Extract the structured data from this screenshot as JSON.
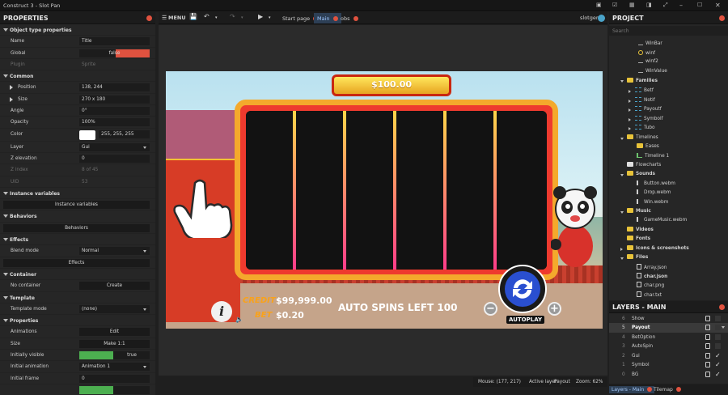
{
  "window": {
    "title": "Construct 3 - Slot Pan"
  },
  "properties": {
    "title": "PROPERTIES",
    "object_type_section": "Object type properties",
    "name_label": "Name",
    "name_value": "Title",
    "global_label": "Global",
    "global_value": "false",
    "plugin_label": "Plugin",
    "plugin_value": "Sprite",
    "common_section": "Common",
    "position_label": "Position",
    "position_value": "138, 244",
    "size_label": "Size",
    "size_value": "270 x 180",
    "angle_label": "Angle",
    "angle_value": "0°",
    "opacity_label": "Opacity",
    "opacity_value": "100%",
    "color_label": "Color",
    "color_value": "255, 255, 255",
    "layer_label": "Layer",
    "layer_value": "Gui",
    "zelev_label": "Z elevation",
    "zelev_value": "0",
    "zindex_label": "Z index",
    "zindex_value": "8 of 45",
    "uid_label": "UID",
    "uid_value": "53",
    "instvars_section": "Instance variables",
    "instvars_button": "Instance variables",
    "behaviors_section": "Behaviors",
    "behaviors_button": "Behaviors",
    "effects_section": "Effects",
    "blend_label": "Blend mode",
    "blend_value": "Normal",
    "effects_button": "Effects",
    "container_section": "Container",
    "nocontainer_label": "No container",
    "create_button": "Create",
    "template_section": "Template",
    "templatemode_label": "Template mode",
    "templatemode_value": "(none)",
    "properties_section": "Properties",
    "animations_label": "Animations",
    "edit_button": "Edit",
    "size2_label": "Size",
    "make11_button": "Make 1:1",
    "initvis_label": "Initially visible",
    "initvis_value": "true",
    "initanim_label": "Initial animation",
    "initanim_value": "Animation 1",
    "initframe_label": "Initial frame",
    "initframe_value": "0"
  },
  "toolbar": {
    "menu": "MENU",
    "tabs": [
      {
        "label": "Start page"
      },
      {
        "label": "Main"
      },
      {
        "label": "obs"
      }
    ],
    "user": "slotgen"
  },
  "status": {
    "mouse": "Mouse: (177, 217)",
    "layer_label": "Active layer:",
    "layer_value": "Payout",
    "zoom": "Zoom: 62%"
  },
  "game": {
    "banner": "$100.00",
    "credit_label": "CREDIT",
    "credit_value": "$99,999.00",
    "bet_label": "BET",
    "bet_value": "$0.20",
    "auto_spins": "AUTO SPINS LEFT 100",
    "autoplay": "AUTOPLAY",
    "info": "i",
    "minus": "−",
    "plus": "+"
  },
  "project": {
    "title": "PROJECT",
    "search_placeholder": "Search",
    "items": [
      "WinBar",
      "winf",
      "winf2",
      "WinValue",
      "Families",
      "Betf",
      "Notif",
      "Payoutf",
      "Symbolf",
      "Tubo",
      "Timelines",
      "Eases",
      "Timeline 1",
      "Flowcharts",
      "Sounds",
      "Button.webm",
      "Drop.webm",
      "Win.webm",
      "Music",
      "GameMusic.webm",
      "Videos",
      "Fonts",
      "Icons & screenshots",
      "Files",
      "Array.json",
      "char.json",
      "char.png",
      "char.txt"
    ]
  },
  "layers": {
    "title": "LAYERS - MAIN",
    "rows": [
      {
        "n": "6",
        "l": "Show"
      },
      {
        "n": "5",
        "l": "Payout"
      },
      {
        "n": "4",
        "l": "BetOption"
      },
      {
        "n": "3",
        "l": "AutoSpin"
      },
      {
        "n": "2",
        "l": "Gui"
      },
      {
        "n": "1",
        "l": "Symbol"
      },
      {
        "n": "0",
        "l": "BG"
      }
    ]
  },
  "bottom_tabs": {
    "layers": "Layers - Main",
    "tilemap": "Tilemap"
  },
  "colors": {
    "accent": "#e0523f",
    "active_tab": "#2d3f55",
    "reel_frame": "#f4a92c",
    "reel_bg": "#121212"
  }
}
